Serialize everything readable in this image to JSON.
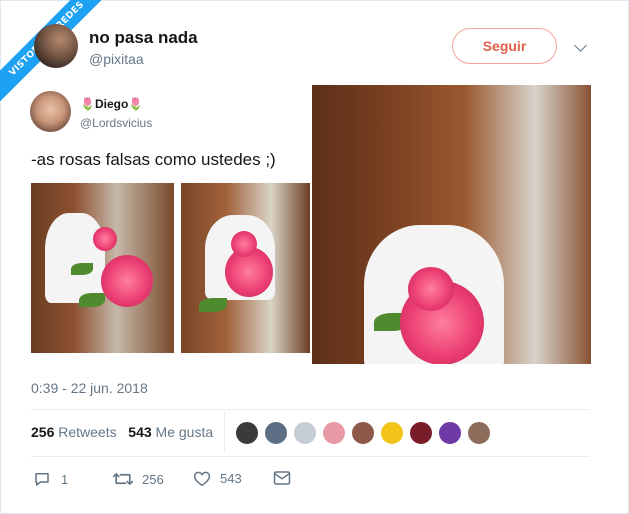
{
  "watermark": "VISTOENLASREDES",
  "author": {
    "name": "no pasa nada",
    "handle": "@pixitaa"
  },
  "follow_label": "Seguir",
  "quoted": {
    "name": "🌷Diego🌷",
    "handle": "@Lordsvicius"
  },
  "tweet_text": "‐as rosas falsas como ustedes ;)",
  "timestamp": "0:39 - 22 jun. 2018",
  "stats": {
    "retweets_count": "256",
    "retweets_label": "Retweets",
    "likes_count": "543",
    "likes_label": "Me gusta"
  },
  "actions": {
    "reply_count": "1",
    "retweet_count": "256",
    "like_count": "543"
  },
  "icons": [
    "reply-icon",
    "retweet-icon",
    "heart-icon",
    "mail-icon",
    "chevron-down-icon"
  ],
  "colors": {
    "accent": "#1da1f2",
    "follow": "#e25f4a",
    "muted": "#657786"
  }
}
